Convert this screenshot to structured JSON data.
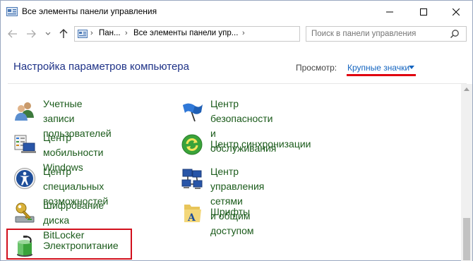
{
  "window": {
    "title": "Все элементы панели управления"
  },
  "navigation": {
    "breadcrumbs": [
      "Пан...",
      "Все элементы панели упр..."
    ],
    "search_placeholder": "Поиск в панели управления"
  },
  "header": {
    "title": "Настройка параметров компьютера",
    "view_label": "Просмотр:",
    "view_value": "Крупные значки"
  },
  "items": [
    {
      "label": "Учетные записи\nпользователей",
      "icon": "users-icon"
    },
    {
      "label": "Центр безопасности и\nобслуживания",
      "icon": "flag-icon"
    },
    {
      "label": "Центр мобильности\nWindows",
      "icon": "mobility-center-icon"
    },
    {
      "label": "Центр синхронизации",
      "icon": "sync-center-icon"
    },
    {
      "label": "Центр специальных\nвозможностей",
      "icon": "ease-of-access-icon"
    },
    {
      "label": "Центр управления сетями\nи общим доступом",
      "icon": "network-center-icon"
    },
    {
      "label": "Шифрование диска\nBitLocker",
      "icon": "bitlocker-key-icon"
    },
    {
      "label": "Шрифты",
      "icon": "fonts-folder-icon"
    },
    {
      "label": "Электропитание",
      "icon": "power-options-icon"
    }
  ],
  "colors": {
    "link_green": "#1b5b1b",
    "header_blue": "#1e3287",
    "accent_red": "#d2101c",
    "view_blue": "#1565c0"
  }
}
